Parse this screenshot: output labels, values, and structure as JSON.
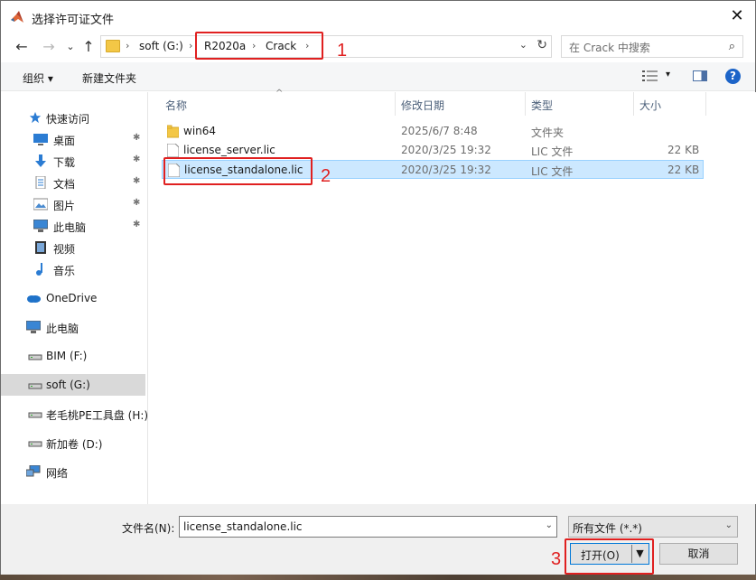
{
  "window": {
    "title": "选择许可证文件",
    "close_glyph": "✕"
  },
  "nav": {
    "back": "←",
    "forward": "→",
    "dropdown": "⌄",
    "up": "↑"
  },
  "address": {
    "crumbs": [
      "soft (G:)",
      "R2020a",
      "Crack"
    ],
    "separator": "›",
    "dropdown": "⌄",
    "refresh": "↻"
  },
  "search": {
    "placeholder": "在 Crack 中搜索",
    "icon": "⌕"
  },
  "annotations": {
    "one": "1",
    "two": "2",
    "three": "3",
    "color": "#e02020"
  },
  "toolbar": {
    "organize": "组织 ▾",
    "new_folder": "新建文件夹",
    "view_dd": "▾",
    "help": "?"
  },
  "sidebar": {
    "items": [
      {
        "label": "快速访问",
        "icon": "star-icon"
      },
      {
        "label": "桌面",
        "icon": "desktop-icon",
        "pinned": true
      },
      {
        "label": "下载",
        "icon": "download-icon",
        "pinned": true
      },
      {
        "label": "文档",
        "icon": "document-icon",
        "pinned": true
      },
      {
        "label": "图片",
        "icon": "picture-icon",
        "pinned": true
      },
      {
        "label": "此电脑",
        "icon": "computer-icon",
        "pinned": true
      },
      {
        "label": "视频",
        "icon": "video-icon"
      },
      {
        "label": "音乐",
        "icon": "music-icon"
      },
      {
        "label": "OneDrive",
        "icon": "cloud-icon"
      },
      {
        "label": "此电脑",
        "icon": "computer-icon"
      },
      {
        "label": "BIM (F:)",
        "icon": "drive-icon"
      },
      {
        "label": "soft (G:)",
        "icon": "drive-icon",
        "selected": true
      },
      {
        "label": "老毛桃PE工具盘 (H:)",
        "icon": "drive-icon"
      },
      {
        "label": "新加卷 (D:)",
        "icon": "drive-icon"
      },
      {
        "label": "网络",
        "icon": "network-icon"
      }
    ],
    "pin_glyph": "📌"
  },
  "columns": {
    "name": "名称",
    "modified": "修改日期",
    "type": "类型",
    "size": "大小",
    "sort_caret": "^"
  },
  "files": [
    {
      "name": "win64",
      "modified": "2025/6/7 8:48",
      "type": "文件夹",
      "size": "",
      "kind": "folder"
    },
    {
      "name": "license_server.lic",
      "modified": "2020/3/25 19:32",
      "type": "LIC 文件",
      "size": "22 KB",
      "kind": "file"
    },
    {
      "name": "license_standalone.lic",
      "modified": "2020/3/25 19:32",
      "type": "LIC 文件",
      "size": "22 KB",
      "kind": "file",
      "selected": true
    }
  ],
  "bottom": {
    "filename_label": "文件名(N):",
    "filename_value": "license_standalone.lic",
    "filter_value": "所有文件 (*.*)",
    "dd": "⌄",
    "open_label": "打开(O)",
    "open_split": "▼",
    "cancel_label": "取消"
  }
}
